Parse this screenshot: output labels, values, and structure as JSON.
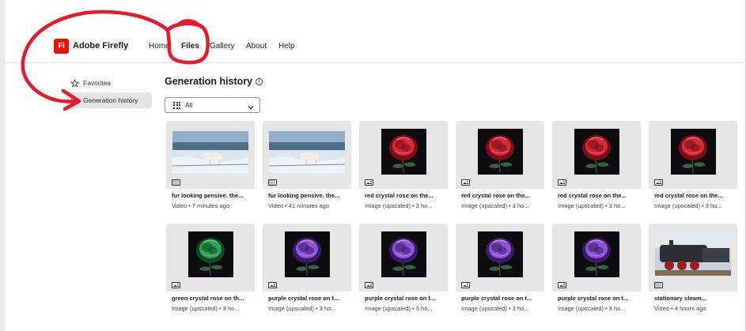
{
  "app": {
    "logo_text": "Fi",
    "brand": "Adobe Firefly"
  },
  "nav": {
    "home": "Home",
    "files": "Files",
    "gallery": "Gallery",
    "about": "About",
    "help": "Help"
  },
  "sidebar": {
    "items": [
      {
        "label": "Favorites",
        "icon": "star-icon"
      },
      {
        "label": "Generation history",
        "icon": "clock-icon"
      }
    ]
  },
  "main": {
    "title": "Generation history",
    "filter_value": "All",
    "cards": [
      {
        "title": "fur looking pensive. the...",
        "meta": "Video • 7 minutes ago",
        "kind": "video",
        "image": "polar-bear"
      },
      {
        "title": "fur looking pensive. the...",
        "meta": "Video • 41 minutes ago",
        "kind": "video",
        "image": "polar-bear"
      },
      {
        "title": "red crystal rose on the...",
        "meta": "Image (upscaled) • 3 ho...",
        "kind": "image",
        "image": "red-rose"
      },
      {
        "title": "red crystal rose on the...",
        "meta": "Image (upscaled) • 3 ho...",
        "kind": "image",
        "image": "red-rose"
      },
      {
        "title": "red crystal rose on the...",
        "meta": "Image (upscaled) • 3 ho...",
        "kind": "image",
        "image": "red-rose"
      },
      {
        "title": "red crystal rose on the...",
        "meta": "Image (upscaled) • 3 ho...",
        "kind": "image",
        "image": "red-rose"
      },
      {
        "title": "green crystal rose on th...",
        "meta": "Image (upscaled) • 3 ho...",
        "kind": "image",
        "image": "green-rose"
      },
      {
        "title": "purple crystal rose on t...",
        "meta": "Image (upscaled) • 3 ho...",
        "kind": "image",
        "image": "purple-rose"
      },
      {
        "title": "purple crystal rose on t...",
        "meta": "Image (upscaled) • 3 ho...",
        "kind": "image",
        "image": "purple-rose"
      },
      {
        "title": "purple crystal rose on t...",
        "meta": "Image (upscaled) • 3 ho...",
        "kind": "image",
        "image": "purple-rose"
      },
      {
        "title": "purple crystal rose on t...",
        "meta": "Image (upscaled) • 3 ho...",
        "kind": "image",
        "image": "purple-rose"
      },
      {
        "title": "stationary steam...",
        "meta": "Video • 4 hours ago",
        "kind": "video",
        "image": "steam-train"
      }
    ]
  },
  "colors": {
    "brand_red": "#eb1000",
    "annotation_red": "#e8192c",
    "card_bg": "#e6e6e6",
    "active_sidebar": "#e4e4e4"
  }
}
